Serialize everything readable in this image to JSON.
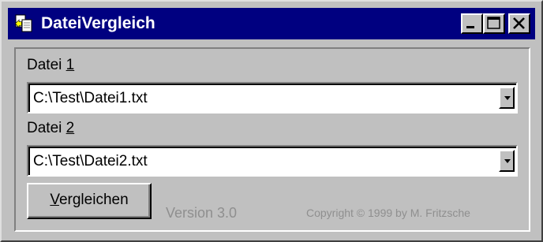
{
  "window": {
    "title": "DateiVergleich",
    "icon": "files-compare-icon",
    "controls": {
      "minimize": "minimize-icon",
      "maximize": "maximize-icon",
      "close": "close-icon"
    }
  },
  "file1": {
    "label_prefix": "Datei ",
    "label_accel": "1",
    "value": "C:\\Test\\Datei1.txt"
  },
  "file2": {
    "label_prefix": "Datei ",
    "label_accel": "2",
    "value": "C:\\Test\\Datei2.txt"
  },
  "compare_button": {
    "accel": "V",
    "rest": "ergleichen"
  },
  "footer": {
    "version": "Version 3.0",
    "copyright": "Copyright © 1999 by M. Fritzsche"
  },
  "colors": {
    "titlebar": "#000080",
    "face": "#c0c0c0",
    "disabled_text": "#8f8f8f"
  }
}
